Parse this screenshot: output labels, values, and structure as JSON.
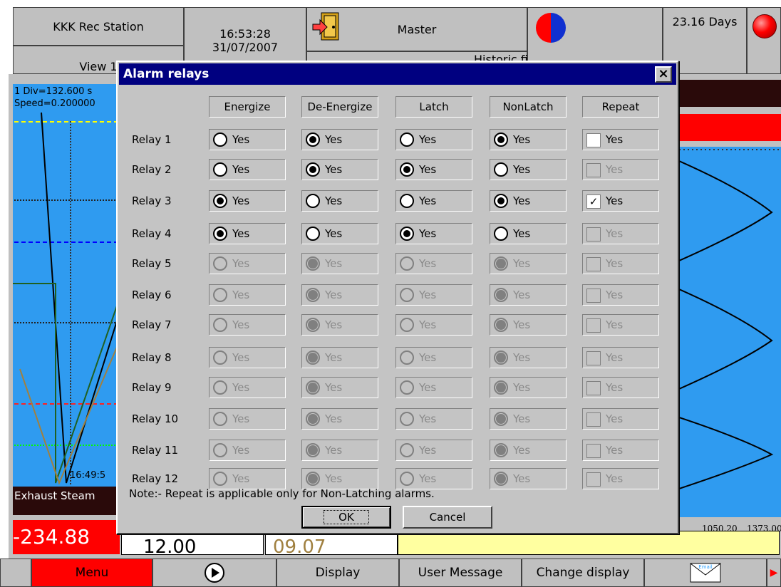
{
  "header": {
    "station": "KKK Rec Station",
    "view": "View 1",
    "time": "16:53:28",
    "date": "31/07/2007",
    "role": "Master",
    "status": "Historic file is displayed",
    "uptime": "23.16 Days"
  },
  "chart": {
    "div_text": "1 Div=132.600 s",
    "speed_text": "Speed=0.200000",
    "time_mark": "16:49:5",
    "channel_name": "Exhaust Steam",
    "channel_value": "-234.88",
    "value2": "12.00",
    "value3": "09.07",
    "scale_min": "1050.20",
    "scale_max": "1373.00"
  },
  "dialog": {
    "title": "Alarm relays",
    "close": "×",
    "columns": [
      "Energize",
      "De-Energize",
      "Latch",
      "NonLatch",
      "Repeat"
    ],
    "yes_label": "Yes",
    "note": "Note:- Repeat is applicable only for Non-Latching alarms.",
    "ok": "OK",
    "cancel": "Cancel",
    "relays": [
      {
        "label": "Relay 1",
        "enabled": true,
        "energize": false,
        "latch": false,
        "repeat": false,
        "repeat_enabled": true
      },
      {
        "label": "Relay 2",
        "enabled": true,
        "energize": false,
        "latch": true,
        "repeat": false,
        "repeat_enabled": false
      },
      {
        "label": "Relay 3",
        "enabled": true,
        "energize": true,
        "latch": false,
        "repeat": true,
        "repeat_enabled": true
      },
      {
        "label": "Relay 4",
        "enabled": true,
        "energize": true,
        "latch": true,
        "repeat": false,
        "repeat_enabled": false
      },
      {
        "label": "Relay 5",
        "enabled": false,
        "energize": false,
        "latch": false,
        "repeat": false,
        "repeat_enabled": false
      },
      {
        "label": "Relay 6",
        "enabled": false,
        "energize": false,
        "latch": false,
        "repeat": false,
        "repeat_enabled": false
      },
      {
        "label": "Relay 7",
        "enabled": false,
        "energize": false,
        "latch": false,
        "repeat": false,
        "repeat_enabled": false
      },
      {
        "label": "Relay 8",
        "enabled": false,
        "energize": false,
        "latch": false,
        "repeat": false,
        "repeat_enabled": false
      },
      {
        "label": "Relay 9",
        "enabled": false,
        "energize": false,
        "latch": false,
        "repeat": false,
        "repeat_enabled": false
      },
      {
        "label": "Relay 10",
        "enabled": false,
        "energize": false,
        "latch": false,
        "repeat": false,
        "repeat_enabled": false
      },
      {
        "label": "Relay 11",
        "enabled": false,
        "energize": false,
        "latch": false,
        "repeat": false,
        "repeat_enabled": false
      },
      {
        "label": "Relay 12",
        "enabled": false,
        "energize": false,
        "latch": false,
        "repeat": false,
        "repeat_enabled": false
      }
    ]
  },
  "bottom_bar": {
    "menu": "Menu",
    "display": "Display",
    "user_message": "User Message",
    "change_display": "Change display",
    "email_icon_text": "Email"
  },
  "colors": {
    "chart_bg": "#2f9bf0",
    "alarm_red": "#ff0000",
    "title_bar": "#000080",
    "panel_gray": "#c0c0c0"
  },
  "icons": [
    "exit-door-icon",
    "status-pie-icon",
    "alarm-led-icon",
    "play-icon",
    "email-icon",
    "arrow-right-icon"
  ]
}
